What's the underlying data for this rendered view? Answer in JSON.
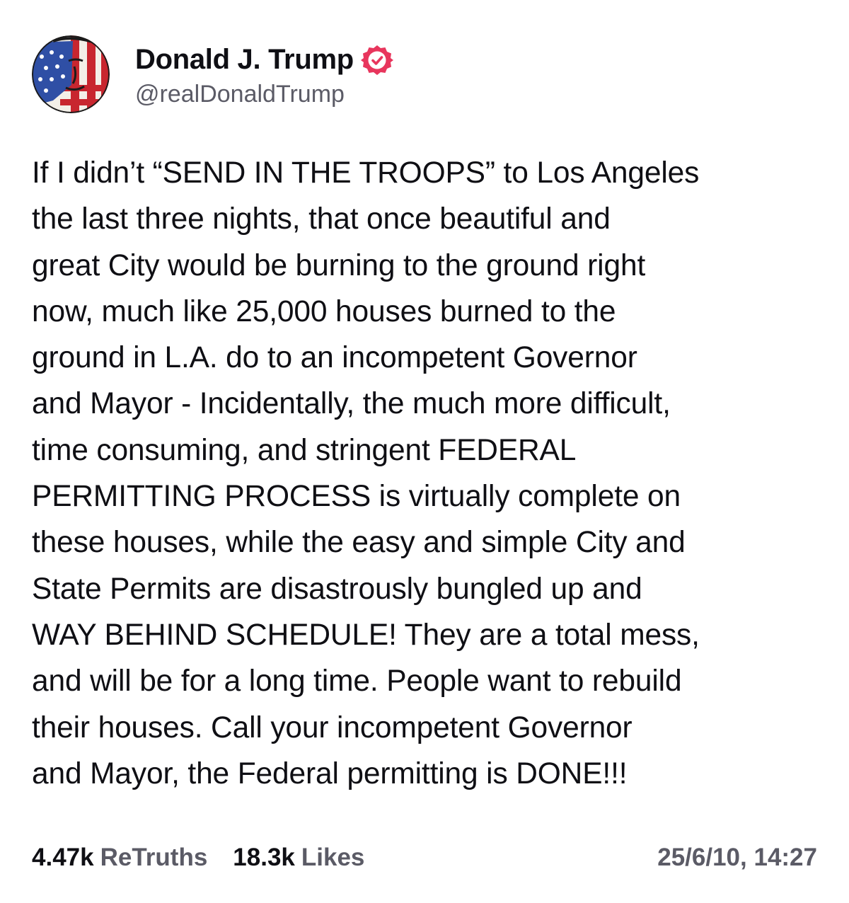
{
  "author": {
    "display_name": "Donald J. Trump",
    "handle": "@realDonaldTrump",
    "verified": true,
    "avatar_icon": "flag-painted-portrait-avatar",
    "verified_icon": "verified-badge-icon"
  },
  "post": {
    "text": "If I didn’t “SEND IN THE TROOPS” to Los Angeles\nthe last three nights, that once beautiful and\ngreat City would be burning to the ground right\nnow, much like 25,000 houses burned to the\nground in L.A. do to an incompetent Governor\nand Mayor - Incidentally, the much more difficult,\ntime consuming, and stringent FEDERAL\nPERMITTING PROCESS is virtually complete on\nthese houses, while the easy and simple City and\nState Permits are disastrously bungled up and\nWAY BEHIND SCHEDULE! They are a total mess,\nand will be for a long time. People want to rebuild\ntheir houses. Call your incompetent Governor\nand Mayor, the Federal permitting is DONE!!!"
  },
  "stats": {
    "retruths_count": "4.47k",
    "retruths_label": "ReTruths",
    "likes_count": "18.3k",
    "likes_label": "Likes",
    "timestamp": "25/6/10, 14:27"
  },
  "colors": {
    "text_primary": "#0f0f14",
    "text_secondary": "#5b5b66",
    "verified_badge": "#e8365d",
    "background": "#ffffff"
  }
}
